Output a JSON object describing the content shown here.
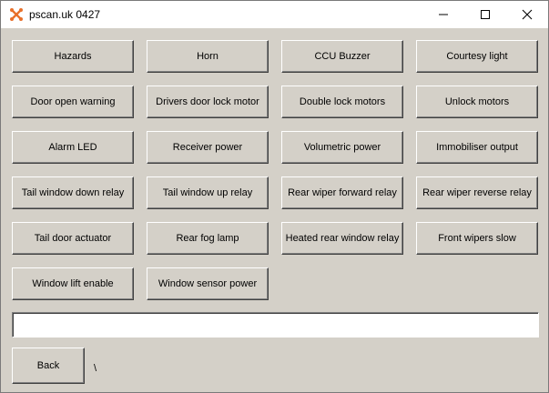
{
  "window": {
    "title": "pscan.uk 0427",
    "icon": "pscan-logo-icon"
  },
  "buttons": [
    [
      "Hazards",
      "Horn",
      "CCU Buzzer",
      "Courtesy light"
    ],
    [
      "Door open warning",
      "Drivers door lock motor",
      "Double lock motors",
      "Unlock motors"
    ],
    [
      "Alarm LED",
      "Receiver power",
      "Volumetric power",
      "Immobiliser output"
    ],
    [
      "Tail window down relay",
      "Tail window up relay",
      "Rear wiper forward relay",
      "Rear wiper reverse relay"
    ],
    [
      "Tail door actuator",
      "Rear fog lamp",
      "Heated rear window relay",
      "Front wipers slow"
    ],
    [
      "Window lift enable",
      "Window sensor power"
    ]
  ],
  "input": {
    "value": ""
  },
  "footer": {
    "back_label": "Back",
    "status_text": "\\"
  }
}
